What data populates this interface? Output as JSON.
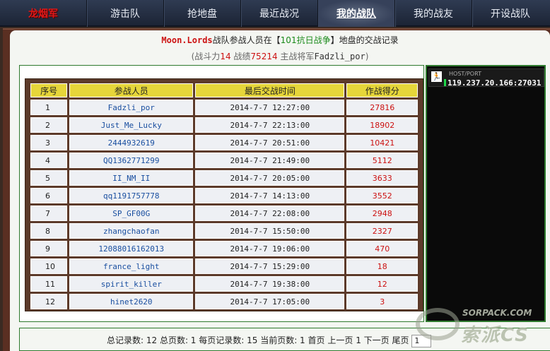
{
  "nav": {
    "logo": "龙烟军",
    "tabs": [
      "游击队",
      "抢地盘",
      "最近战况",
      "我的战队",
      "我的战友",
      "开设战队"
    ],
    "active_tab": "我的战队"
  },
  "header": {
    "team_name": "Moon.Lords",
    "title_mid": "战队参战人员在【",
    "map_name": "101抗日战争",
    "title_end": "】地盘的交战记录",
    "sub_open": "(战斗力",
    "power": "14",
    "sub_score_label": " 战绩",
    "score": "75214",
    "sub_leader_label": " 主战将军",
    "leader": "Fadzli_por",
    "sub_close": ")"
  },
  "table": {
    "columns": [
      "序号",
      "参战人员",
      "最后交战时间",
      "作战得分"
    ],
    "rows": [
      {
        "idx": "1",
        "name": "Fadzli_por",
        "time": "2014-7-7 12:27:00",
        "score": "27816"
      },
      {
        "idx": "2",
        "name": "Just_Me_Lucky",
        "time": "2014-7-7 22:13:00",
        "score": "18902"
      },
      {
        "idx": "3",
        "name": "2444932619",
        "time": "2014-7-7 20:51:00",
        "score": "10421"
      },
      {
        "idx": "4",
        "name": "QQ1362771299",
        "time": "2014-7-7 21:49:00",
        "score": "5112"
      },
      {
        "idx": "5",
        "name": "II_NM_II",
        "time": "2014-7-7 20:05:00",
        "score": "3633"
      },
      {
        "idx": "6",
        "name": "qq1191757778",
        "time": "2014-7-7 14:13:00",
        "score": "3552"
      },
      {
        "idx": "7",
        "name": "SP_GF00G",
        "time": "2014-7-7 22:08:00",
        "score": "2948"
      },
      {
        "idx": "8",
        "name": "zhangchaofan",
        "time": "2014-7-7 15:50:00",
        "score": "2327"
      },
      {
        "idx": "9",
        "name": "12088016162013",
        "time": "2014-7-7 19:06:00",
        "score": "470"
      },
      {
        "idx": "10",
        "name": "france_light",
        "time": "2014-7-7 15:29:00",
        "score": "18"
      },
      {
        "idx": "11",
        "name": "spirit_killer",
        "time": "2014-7-7 19:38:00",
        "score": "12"
      },
      {
        "idx": "12",
        "name": "hinet2620",
        "time": "2014-7-7 17:05:00",
        "score": "3"
      }
    ]
  },
  "footer": {
    "summary": "总记录数: 12 总页数: 1 每页记录数: 15 当前页数: 1",
    "first": "首页",
    "prev": "上一页",
    "sep1": " 1 ",
    "next": "下一页",
    "last": "尾页",
    "page_value": "1"
  },
  "server": {
    "label": "HOST/PORT",
    "address": "119.237.20.166:27031",
    "icon": "running-man-icon"
  },
  "watermark": {
    "line1": "SORPACK.COM",
    "line2": "索派CS"
  },
  "colors": {
    "accent_red": "#cc1111",
    "header_yellow": "#e6d63a",
    "frame_green": "#2e7a2e"
  }
}
